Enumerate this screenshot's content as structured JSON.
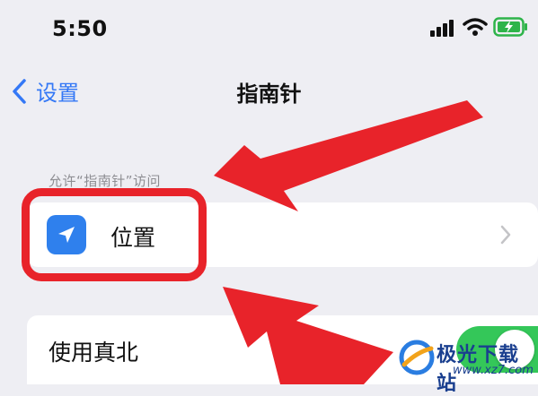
{
  "status_bar": {
    "time": "5:50"
  },
  "nav": {
    "back_label": "设置",
    "title": "指南针"
  },
  "section": {
    "header": "允许“指南针”访问"
  },
  "rows": {
    "location_label": "位置",
    "true_north_label": "使用真北",
    "true_north_enabled": true
  },
  "icons": {
    "back": "chevron-left-icon",
    "location": "location-arrow-icon",
    "disclosure": "chevron-right-icon",
    "signal": "cellular-signal-icon",
    "wifi": "wifi-icon",
    "battery": "battery-charging-icon"
  },
  "colors": {
    "accent": "#3478f6",
    "toggle_on": "#34c759",
    "annotation_red": "#e8232a",
    "location_icon_bg": "#2f80ed"
  },
  "watermark": {
    "title": "极光下载站",
    "url": "www.xz7.com"
  }
}
